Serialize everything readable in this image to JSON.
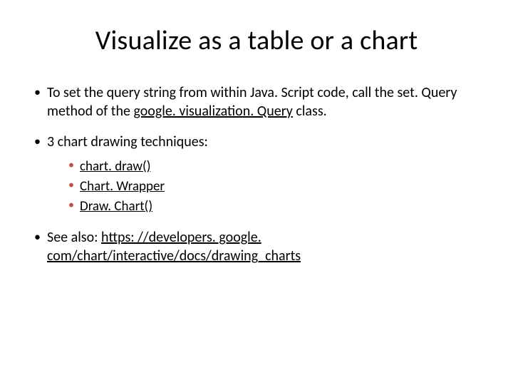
{
  "title": "Visualize as a table or a chart",
  "b1_pre": "To set the query string from within Java. Script code, call the set. Query method of the ",
  "b1_link": "google. visualization. Query",
  "b1_post": " class.",
  "b2": "3 chart drawing techniques:",
  "s1": "chart. draw()",
  "s2": "Chart. Wrapper",
  "s3": "Draw. Chart()",
  "b3_pre": "See also: ",
  "b3_link": "https: //developers. google. com/chart/interactive/docs/drawing_charts"
}
